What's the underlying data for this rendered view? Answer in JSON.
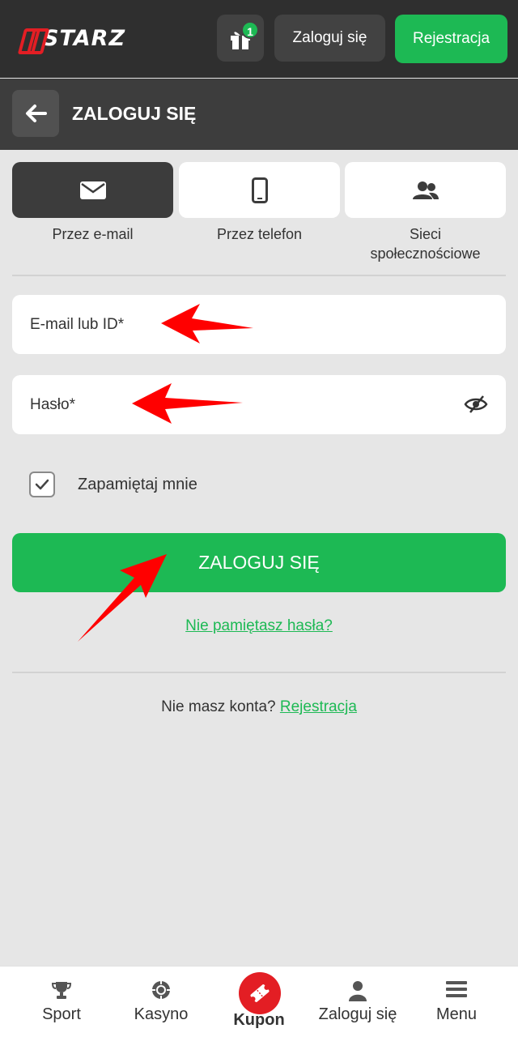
{
  "header": {
    "logo_text": "STARZ",
    "gift_badge": "1",
    "login_label": "Zaloguj się",
    "register_label": "Rejestracja"
  },
  "subheader": {
    "title": "ZALOGUJ SIĘ"
  },
  "login_methods": [
    {
      "label": "Przez e-mail",
      "icon": "envelope-icon",
      "active": true
    },
    {
      "label": "Przez telefon",
      "icon": "phone-icon",
      "active": false
    },
    {
      "label_line1": "Sieci",
      "label_line2": "społecznościowe",
      "icon": "users-icon",
      "active": false
    }
  ],
  "form": {
    "email_label": "E-mail lub ID*",
    "password_label": "Hasło*",
    "remember_label": "Zapamiętaj mnie",
    "remember_checked": true,
    "submit_label": "ZALOGUJ SIĘ",
    "forgot_label": "Nie pamiętasz hasła?",
    "no_account_text": "Nie masz konta?",
    "register_link": "Rejestracja"
  },
  "bottom_nav": [
    {
      "label": "Sport",
      "icon": "trophy-icon"
    },
    {
      "label": "Kasyno",
      "icon": "casino-chip-icon"
    },
    {
      "label": "Kupon",
      "icon": "ticket-icon"
    },
    {
      "label": "Zaloguj się",
      "icon": "user-icon"
    },
    {
      "label": "Menu",
      "icon": "hamburger-icon"
    }
  ],
  "colors": {
    "accent_green": "#1db954",
    "brand_red": "#e31e24",
    "header_dark": "#2f2f2f",
    "background": "#e6e6e6"
  }
}
